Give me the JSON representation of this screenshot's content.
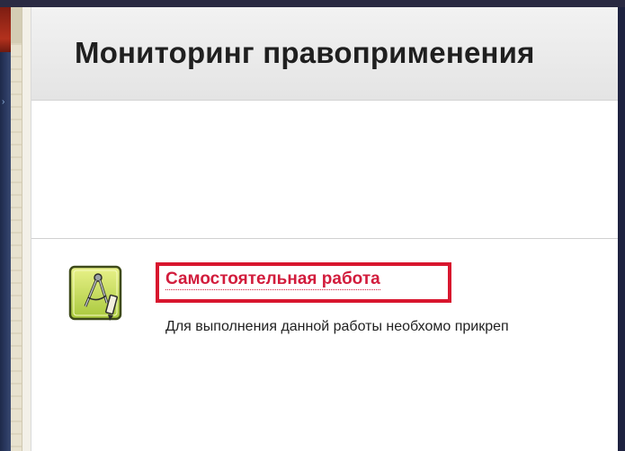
{
  "page": {
    "title": "Мониторинг правоприменения"
  },
  "activity": {
    "icon": "assignment-compass-icon",
    "link_label": "Самостоятельная работа",
    "description": "Для выполнения данной работы необхомо прикреп"
  },
  "colors": {
    "highlight_border": "#d8162e",
    "link": "#d21c3c",
    "top_bar": "#2a2a42"
  }
}
